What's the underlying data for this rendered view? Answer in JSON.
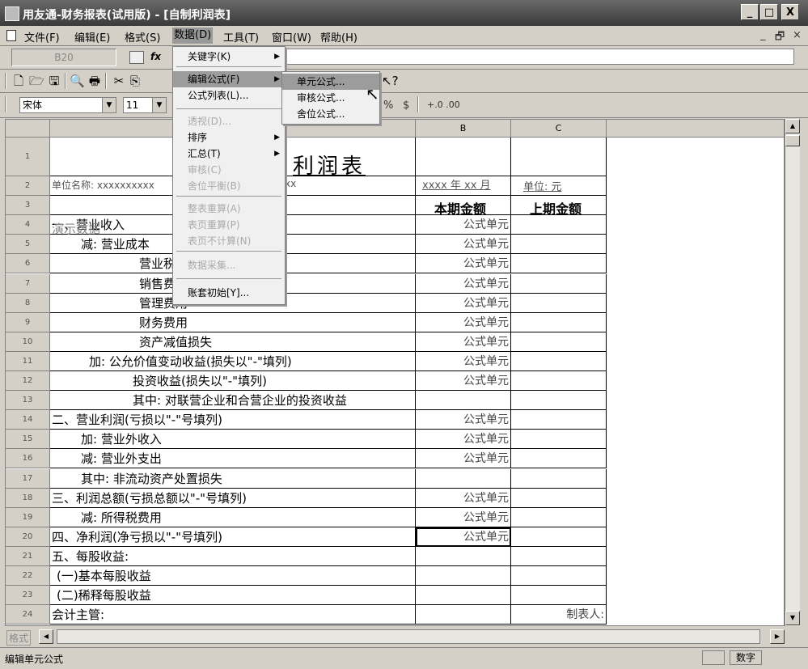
{
  "window": {
    "title": "用友通-财务报表(试用版) - [自制利润表]",
    "min_label": "_",
    "max_label": "□",
    "close_label": "X"
  },
  "menubar": {
    "items": [
      "文件(F)",
      "编辑(E)",
      "格式(S)",
      "数据(D)",
      "工具(T)",
      "窗口(W)",
      "帮助(H)"
    ],
    "mdi_min": "_",
    "mdi_restore": "🗗",
    "mdi_close": "×"
  },
  "formula_bar": {
    "cell_ref": "B20",
    "fx_label": "fx"
  },
  "format_bar": {
    "font_name": "宋体",
    "font_size": "11",
    "percent": "%",
    "currency": "$",
    "inc_decimal": "+.0 .00",
    "dec_decimal": ".00"
  },
  "data_menu": {
    "items": [
      {
        "label": "关键字(K)",
        "submenu": true,
        "disabled": false
      },
      {
        "label": "编辑公式(F)",
        "submenu": true,
        "disabled": false,
        "highlight": true
      },
      {
        "label": "公式列表(L)...",
        "submenu": false,
        "disabled": false
      },
      {
        "label": "透视(D)...",
        "submenu": false,
        "disabled": true
      },
      {
        "label": "排序",
        "submenu": true,
        "disabled": false
      },
      {
        "label": "汇总(T)",
        "submenu": true,
        "disabled": false
      },
      {
        "label": "审核(C)",
        "submenu": false,
        "disabled": true
      },
      {
        "label": "舍位平衡(B)",
        "submenu": false,
        "disabled": true
      },
      {
        "label": "整表重算(A)",
        "submenu": false,
        "disabled": true
      },
      {
        "label": "表页重算(P)",
        "submenu": false,
        "disabled": true
      },
      {
        "label": "表页不计算(N)",
        "submenu": false,
        "disabled": true
      },
      {
        "label": "数据采集...",
        "submenu": false,
        "disabled": true
      },
      {
        "label": "账套初始[Y]...",
        "submenu": false,
        "disabled": false
      }
    ]
  },
  "formula_submenu": {
    "items": [
      "单元公式...",
      "审核公式...",
      "舍位公式..."
    ]
  },
  "sheet": {
    "columns": [
      "B",
      "C"
    ],
    "title": "利润表",
    "unit_name": "单位名称: xxxxxxxxxx",
    "unit_name_tail": "xx",
    "period": "xxxx 年 xx 月",
    "unit_label": "单位: 元",
    "header_current": "本期金额",
    "header_previous": "上期金额",
    "rows": [
      {
        "n": "1",
        "label": "",
        "b": "",
        "c": "",
        "indent": 0
      },
      {
        "n": "2",
        "label": "",
        "b": "",
        "c": "",
        "indent": 0
      },
      {
        "n": "3",
        "label": "",
        "b": "",
        "c": "",
        "indent": 0
      },
      {
        "n": "4",
        "label": "一、营业收入",
        "b": "公式单元",
        "c": "",
        "indent": 0
      },
      {
        "n": "5",
        "label": "减: 营业成本",
        "b": "公式单元",
        "c": "",
        "indent": 36
      },
      {
        "n": "6",
        "label": "营业税金及附加",
        "b": "公式单元",
        "c": "",
        "indent": 108
      },
      {
        "n": "7",
        "label": "销售费用",
        "b": "公式单元",
        "c": "",
        "indent": 108
      },
      {
        "n": "8",
        "label": "管理费用",
        "b": "公式单元",
        "c": "",
        "indent": 108
      },
      {
        "n": "9",
        "label": "财务费用",
        "b": "公式单元",
        "c": "",
        "indent": 108
      },
      {
        "n": "10",
        "label": "资产减值损失",
        "b": "公式单元",
        "c": "",
        "indent": 108
      },
      {
        "n": "11",
        "label": "加: 公允价值变动收益(损失以\"-\"填列)",
        "b": "公式单元",
        "c": "",
        "indent": 46
      },
      {
        "n": "12",
        "label": "投资收益(损失以\"-\"填列)",
        "b": "公式单元",
        "c": "",
        "indent": 100
      },
      {
        "n": "13",
        "label": "其中: 对联营企业和合营企业的投资收益",
        "b": "",
        "c": "",
        "indent": 100
      },
      {
        "n": "14",
        "label": "二、营业利润(亏损以\"-\"号填列)",
        "b": "公式单元",
        "c": "",
        "indent": 0
      },
      {
        "n": "15",
        "label": "加: 营业外收入",
        "b": "公式单元",
        "c": "",
        "indent": 36
      },
      {
        "n": "16",
        "label": "减: 营业外支出",
        "b": "公式单元",
        "c": "",
        "indent": 36
      },
      {
        "n": "17",
        "label": "其中: 非流动资产处置损失",
        "b": "",
        "c": "",
        "indent": 36
      },
      {
        "n": "18",
        "label": "三、利润总额(亏损总额以\"-\"号填列)",
        "b": "公式单元",
        "c": "",
        "indent": 0
      },
      {
        "n": "19",
        "label": "减: 所得税费用",
        "b": "公式单元",
        "c": "",
        "indent": 36
      },
      {
        "n": "20",
        "label": "四、净利润(净亏损以\"-\"号填列)",
        "b": "公式单元",
        "c": "",
        "indent": 0
      },
      {
        "n": "21",
        "label": "五、每股收益:",
        "b": "",
        "c": "",
        "indent": 0
      },
      {
        "n": "22",
        "label": "(一)基本每股收益",
        "b": "",
        "c": "",
        "indent": 6
      },
      {
        "n": "23",
        "label": "(二)稀释每股收益",
        "b": "",
        "c": "",
        "indent": 6
      },
      {
        "n": "24",
        "label": "会计主管:",
        "b": "",
        "c": "制表人:",
        "indent": 0
      }
    ],
    "demo_label": "演示数据"
  },
  "bottom": {
    "sheet_tab": "格式"
  },
  "status": {
    "message": "编辑单元公式",
    "num_indicator": "数字"
  }
}
